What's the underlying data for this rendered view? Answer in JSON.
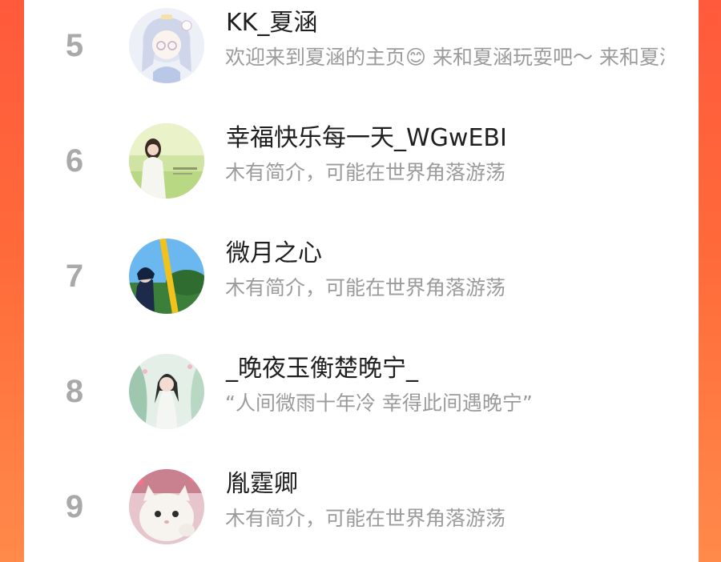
{
  "theme": {
    "background_accent": "#ff5a3c",
    "card_background": "#ffffff",
    "rank_color": "#a9a9ab",
    "name_color": "#1f1f1f",
    "bio_color": "#9b9b9b"
  },
  "users": [
    {
      "rank": "5",
      "name": "KK_夏涵",
      "bio": "欢迎来到夏涵的主页😊 来和夏涵玩耍吧～ 来和夏涵玩耍吧～"
    },
    {
      "rank": "6",
      "name": "幸福快乐每一天_WGwEBI",
      "bio": "木有简介，可能在世界角落游荡"
    },
    {
      "rank": "7",
      "name": "微月之心",
      "bio": "木有简介，可能在世界角落游荡"
    },
    {
      "rank": "8",
      "name": "_晚夜玉衡楚晚宁_",
      "bio": "“人间微雨十年冷 幸得此间遇晚宁”"
    },
    {
      "rank": "9",
      "name": "胤霆卿",
      "bio": "木有简介，可能在世界角落游荡"
    }
  ]
}
